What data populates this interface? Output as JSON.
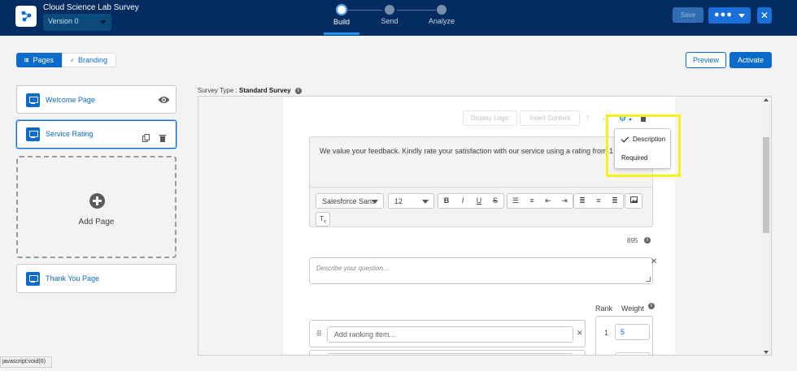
{
  "header": {
    "app_title": "Cloud Science Lab Survey",
    "version": "Version 0",
    "steps": [
      {
        "label": "Build",
        "active": true
      },
      {
        "label": "Send",
        "active": false
      },
      {
        "label": "Analyze",
        "active": false
      }
    ],
    "save_label": "Save",
    "more_label": "●●●",
    "close_label": "✕"
  },
  "toolbar": {
    "pages_label": "Pages",
    "branding_label": "Branding",
    "preview_label": "Preview",
    "activate_label": "Activate"
  },
  "pages": {
    "items": [
      {
        "label": "Welcome Page"
      },
      {
        "label": "Service Rating"
      },
      {
        "label": "Thank You Page"
      }
    ],
    "add_label": "Add Page"
  },
  "survey_type": {
    "label": "Survey Type :",
    "value": "Standard Survey"
  },
  "question": {
    "actions": {
      "display_logic": "Display Logic",
      "insert_content": "Insert Content"
    },
    "text": "We value your feedback. Kindly rate your satisfaction with our service using a rating from 1 to 5.",
    "rte": {
      "font": "Salesforce Sans",
      "size": "12"
    },
    "char_count": "895",
    "description_placeholder": "Describe your question...",
    "rank_header": "Rank",
    "weight_header": "Weight",
    "rank_placeholder": "Add ranking item...",
    "rank_number": "1",
    "weight_value": "5"
  },
  "settings_menu": {
    "items": [
      {
        "label": "Description",
        "checked": true
      },
      {
        "label": "Required",
        "checked": false
      }
    ]
  },
  "status_bar": "javascript:void(0)",
  "colors": {
    "header_bg": "#032d60",
    "brand": "#0b6bcb",
    "highlight": "#f4f21a"
  }
}
